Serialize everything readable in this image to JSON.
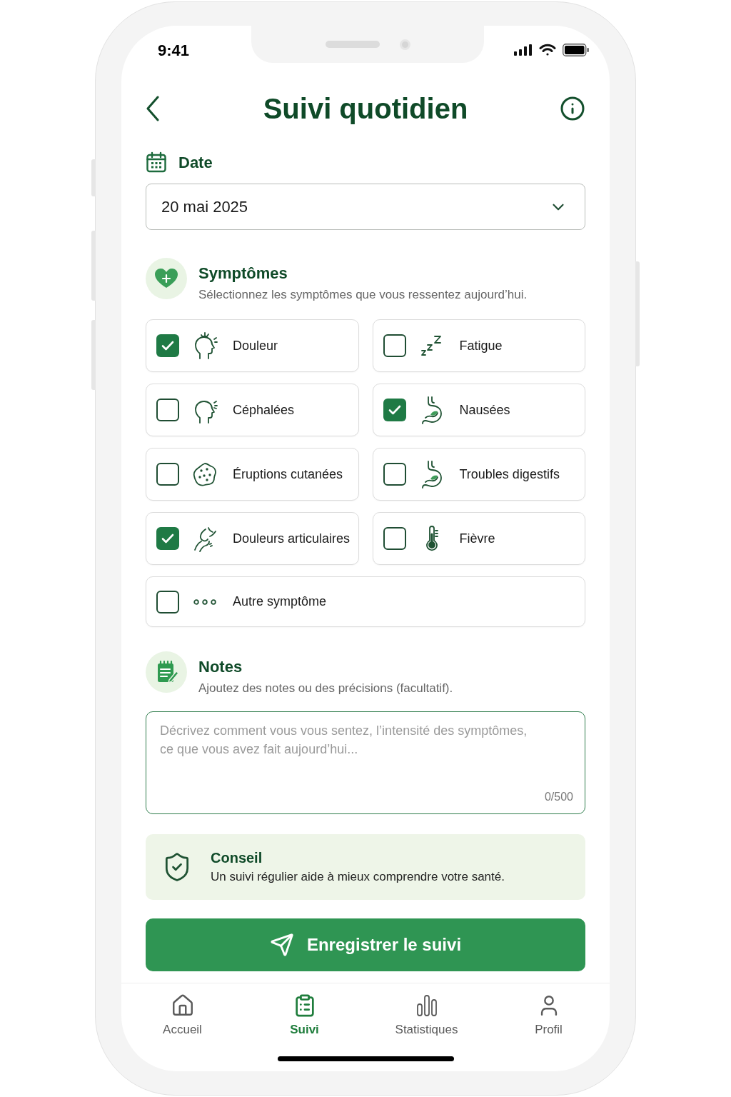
{
  "status_bar": {
    "time": "9:41"
  },
  "header": {
    "title": "Suivi quotidien"
  },
  "date": {
    "label": "Date",
    "value": "20 mai 2025"
  },
  "symptoms": {
    "title": "Symptômes",
    "subtitle": "Sélectionnez les symptômes que vous ressentez aujourd’hui.",
    "items": [
      {
        "label": "Douleur",
        "checked": true
      },
      {
        "label": "Fatigue",
        "checked": false
      },
      {
        "label": "Céphalées",
        "checked": false
      },
      {
        "label": "Nausées",
        "checked": true
      },
      {
        "label": "Éruptions cutanées",
        "checked": false
      },
      {
        "label": "Troubles digestifs",
        "checked": false
      },
      {
        "label": "Douleurs articulaires",
        "checked": true
      },
      {
        "label": "Fièvre",
        "checked": false
      },
      {
        "label": "Autre symptôme",
        "checked": false
      }
    ]
  },
  "notes": {
    "title": "Notes",
    "subtitle": "Ajoutez des notes ou des précisions (facultatif).",
    "placeholder": "Décrivez comment vous vous sentez, l’intensité des symptômes, ce que vous avez fait aujourd’hui...",
    "counter": "0/500"
  },
  "tip": {
    "title": "Conseil",
    "text": "Un suivi régulier aide à mieux comprendre votre santé."
  },
  "submit_button": {
    "label": "Enregistrer le suivi"
  },
  "tab_bar": [
    {
      "label": "Accueil",
      "selected": false
    },
    {
      "label": "Suivi",
      "selected": true
    },
    {
      "label": "Statistiques",
      "selected": false
    },
    {
      "label": "Profil",
      "selected": false
    }
  ]
}
